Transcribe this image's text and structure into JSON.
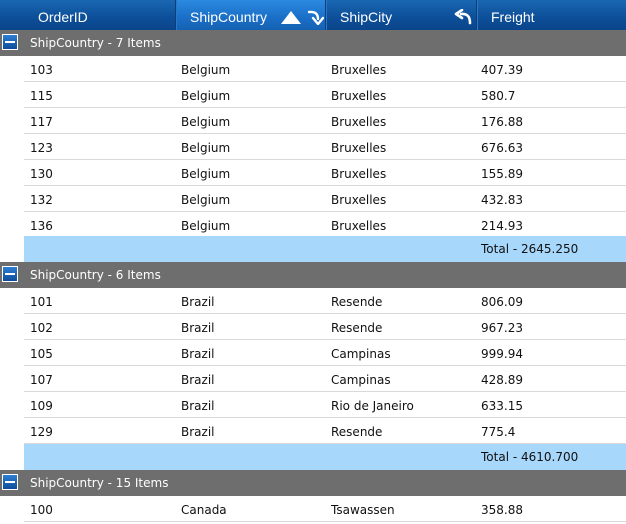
{
  "columns": [
    "OrderID",
    "ShipCountry",
    "ShipCity",
    "Freight"
  ],
  "groups": [
    {
      "title": "ShipCountry - 7 Items",
      "rows": [
        [
          "103",
          "Belgium",
          "Bruxelles",
          "407.39"
        ],
        [
          "115",
          "Belgium",
          "Bruxelles",
          "580.7"
        ],
        [
          "117",
          "Belgium",
          "Bruxelles",
          "176.88"
        ],
        [
          "123",
          "Belgium",
          "Bruxelles",
          "676.63"
        ],
        [
          "130",
          "Belgium",
          "Bruxelles",
          "155.89"
        ],
        [
          "132",
          "Belgium",
          "Bruxelles",
          "432.83"
        ],
        [
          "136",
          "Belgium",
          "Bruxelles",
          "214.93"
        ]
      ],
      "total": "Total - 2645.250"
    },
    {
      "title": "ShipCountry - 6 Items",
      "rows": [
        [
          "101",
          "Brazil",
          "Resende",
          "806.09"
        ],
        [
          "102",
          "Brazil",
          "Resende",
          "967.23"
        ],
        [
          "105",
          "Brazil",
          "Campinas",
          "999.94"
        ],
        [
          "107",
          "Brazil",
          "Campinas",
          "428.89"
        ],
        [
          "109",
          "Brazil",
          "Rio de Janeiro",
          "633.15"
        ],
        [
          "129",
          "Brazil",
          "Resende",
          "775.4"
        ]
      ],
      "total": "Total - 4610.700"
    },
    {
      "title": "ShipCountry - 15 Items",
      "rows": [
        [
          "100",
          "Canada",
          "Tsawassen",
          "358.88"
        ]
      ]
    }
  ],
  "icons": {
    "sort": "sort-ascending-icon",
    "ungroup": "ungroup-arrow-icon",
    "regroup": "undo-arrow-icon",
    "collapse": "collapse-minus-icon"
  },
  "colors": {
    "header": "#0d4f99",
    "header_sorted": "#1a6fc7",
    "group_header": "#6e6e6e",
    "total_row": "#a7d7fb"
  }
}
